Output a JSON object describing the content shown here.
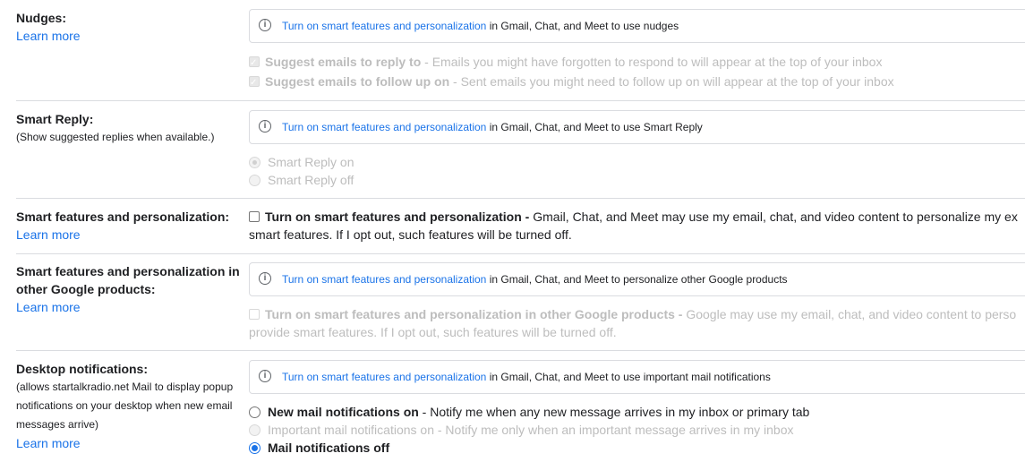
{
  "nudges": {
    "title": "Nudges:",
    "learn_more": "Learn more",
    "banner_link": "Turn on smart features and personalization",
    "banner_rest": " in Gmail, Chat, and Meet to use nudges",
    "opt1_bold": "Suggest emails to reply to",
    "opt1_rest": " - Emails you might have forgotten to respond to will appear at the top of your inbox",
    "opt2_bold": "Suggest emails to follow up on",
    "opt2_rest": " - Sent emails you might need to follow up on will appear at the top of your inbox"
  },
  "smart_reply": {
    "title": "Smart Reply:",
    "subtitle": "(Show suggested replies when available.)",
    "banner_link": "Turn on smart features and personalization",
    "banner_rest": " in Gmail, Chat, and Meet to use Smart Reply",
    "opt_on": "Smart Reply on",
    "opt_off": "Smart Reply off"
  },
  "smart_features": {
    "title": "Smart features and personalization:",
    "learn_more": "Learn more",
    "checkbox_bold": "Turn on smart features and personalization -",
    "line1_rest": " Gmail, Chat, and Meet may use my email, chat, and video content to personalize my ex",
    "line2": "smart features. If I opt out, such features will be turned off."
  },
  "other_products": {
    "title_line1": "Smart features and personalization in",
    "title_line2": "other Google products:",
    "learn_more": "Learn more",
    "banner_link": "Turn on smart features and personalization",
    "banner_rest": " in Gmail, Chat, and Meet to personalize other Google products",
    "checkbox_bold": "Turn on smart features and personalization in other Google products -",
    "line1_rest": " Google may use my email, chat, and video content to perso",
    "line2": "provide smart features. If I opt out, such features will be turned off."
  },
  "desktop": {
    "title": "Desktop notifications:",
    "sub1": "(allows startalkradio.net Mail to display popup",
    "sub2": "notifications on your desktop when new email",
    "sub3": "messages arrive)",
    "learn_more": "Learn more",
    "banner_link": "Turn on smart features and personalization",
    "banner_rest": " in Gmail, Chat, and Meet to use important mail notifications",
    "opt1_bold": "New mail notifications on",
    "opt1_rest": " - Notify me when any new message arrives in my inbox or primary tab",
    "opt2": "Important mail notifications on - Notify me only when an important message arrives in my inbox",
    "opt3_bold": "Mail notifications off"
  },
  "info_icon": "info-circle",
  "colors": {
    "link": "#1a73e8",
    "disabled": "#bdbdbd",
    "border": "#dadce0"
  }
}
